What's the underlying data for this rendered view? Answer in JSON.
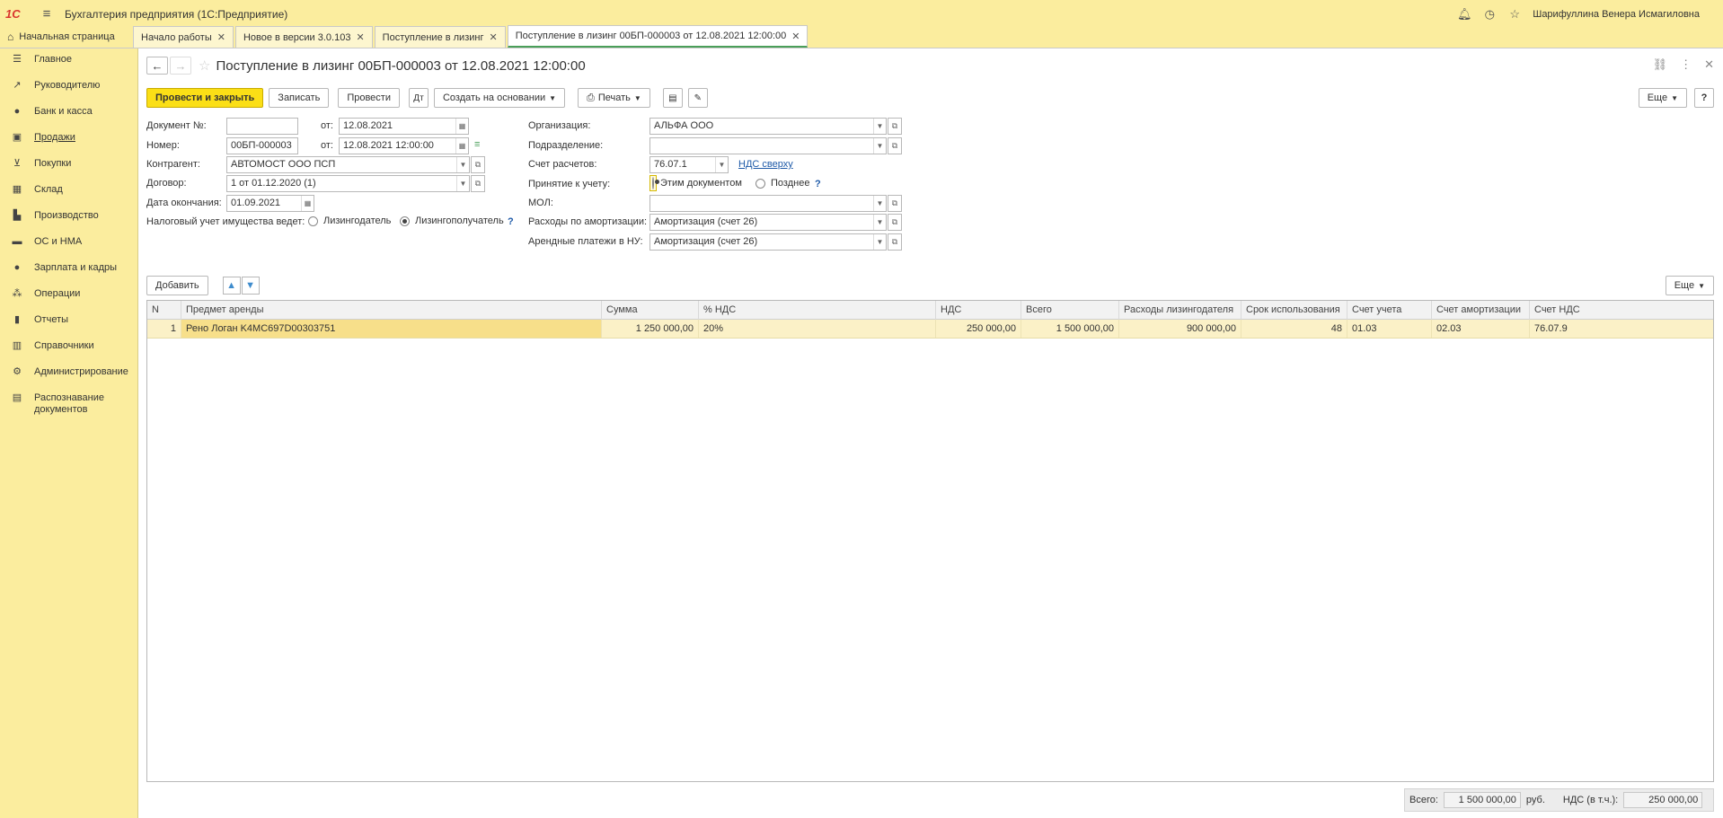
{
  "app": {
    "logo": "1С",
    "title": "Бухгалтерия предприятия  (1С:Предприятие)",
    "user": "Шарифуллина Венера Исмагиловна"
  },
  "tabs": [
    {
      "label": "Начальная страница"
    },
    {
      "label": "Начало работы"
    },
    {
      "label": "Новое в версии 3.0.103"
    },
    {
      "label": "Поступление в лизинг"
    },
    {
      "label": "Поступление в лизинг 00БП-000003 от 12.08.2021 12:00:00"
    }
  ],
  "sidebar": {
    "items": [
      {
        "label": "Главное",
        "icon": "menu-icon"
      },
      {
        "label": "Руководителю",
        "icon": "trend-icon"
      },
      {
        "label": "Банк и касса",
        "icon": "coin-icon"
      },
      {
        "label": "Продажи",
        "icon": "bag-icon"
      },
      {
        "label": "Покупки",
        "icon": "cart-icon"
      },
      {
        "label": "Склад",
        "icon": "warehouse-icon"
      },
      {
        "label": "Производство",
        "icon": "factory-icon"
      },
      {
        "label": "ОС и НМА",
        "icon": "truck-icon"
      },
      {
        "label": "Зарплата и кадры",
        "icon": "person-icon"
      },
      {
        "label": "Операции",
        "icon": "operations-icon"
      },
      {
        "label": "Отчеты",
        "icon": "chart-icon"
      },
      {
        "label": "Справочники",
        "icon": "book-icon"
      },
      {
        "label": "Администрирование",
        "icon": "gear-icon"
      },
      {
        "label": "Распознавание документов",
        "icon": "scan-icon"
      }
    ]
  },
  "document": {
    "title": "Поступление в лизинг 00БП-000003 от 12.08.2021 12:00:00"
  },
  "toolbar": {
    "post_close": "Провести и закрыть",
    "save": "Записать",
    "post": "Провести",
    "create_based": "Создать на основании",
    "print": "Печать",
    "more": "Еще",
    "help": "?"
  },
  "form": {
    "doc_no_label": "Документ №:",
    "doc_no_value": "",
    "from_label": "от:",
    "doc_date": "12.08.2021",
    "number_label": "Номер:",
    "number_value": "00БП-000003",
    "number_date": "12.08.2021 12:00:00",
    "counterparty_label": "Контрагент:",
    "counterparty_value": "АВТОМОСТ ООО ПСП",
    "contract_label": "Договор:",
    "contract_value": "1 от 01.12.2020 (1)",
    "end_date_label": "Дата окончания:",
    "end_date_value": "01.09.2021",
    "tax_label": "Налоговый учет имущества ведет:",
    "tax_opt1": "Лизингодатель",
    "tax_opt2": "Лизингополучатель",
    "org_label": "Организация:",
    "org_value": "АЛЬФА ООО",
    "division_label": "Подразделение:",
    "division_value": "",
    "account_label": "Счет расчетов:",
    "account_value": "76.07.1",
    "vat_link": "НДС сверху",
    "accept_label": "Принятие к учету:",
    "accept_opt1": "Этим документом",
    "accept_opt2": "Позднее",
    "mol_label": "МОЛ:",
    "mol_value": "",
    "amort_label": "Расходы по амортизации:",
    "amort_value": "Амортизация (счет 26)",
    "lease_label": "Арендные платежи в НУ:",
    "lease_value": "Амортизация (счет 26)",
    "help": "?"
  },
  "table": {
    "add": "Добавить",
    "more": "Еще",
    "columns": [
      "N",
      "Предмет аренды",
      "Сумма",
      "% НДС",
      "НДС",
      "Всего",
      "Расходы лизингодателя",
      "Срок использования",
      "Счет учета",
      "Счет амортизации",
      "Счет НДС"
    ],
    "rows": [
      [
        "1",
        "Рено Логан K4MC697D00303751",
        "1 250 000,00",
        "20%",
        "250 000,00",
        "1 500 000,00",
        "900 000,00",
        "48",
        "01.03",
        "02.03",
        "76.07.9"
      ]
    ]
  },
  "totals": {
    "total_label": "Всего:",
    "total_value": "1 500 000,00",
    "currency": "руб.",
    "vat_label": "НДС (в т.ч.):",
    "vat_value": "250 000,00"
  }
}
